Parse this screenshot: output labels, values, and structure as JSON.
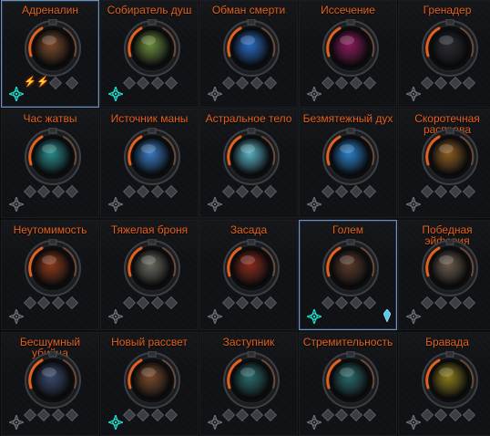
{
  "colors": {
    "label": "#e2611f",
    "selected_border": "#6f8fb8",
    "active_rune": "#20d8c8",
    "inactive_rune": "#6a6e74",
    "crystal": "#56c8e8"
  },
  "abilities": [
    {
      "name": "Адреналин",
      "orb": "#7a4a2a",
      "selected": true,
      "rune": "active",
      "fire_pips": 2
    },
    {
      "name": "Собиратель душ",
      "orb": "#6a8a3a",
      "rune": "active"
    },
    {
      "name": "Обман смерти",
      "orb": "#2a6ac0",
      "rune": "inactive"
    },
    {
      "name": "Иссечение",
      "orb": "#8a1a5a",
      "rune": "inactive"
    },
    {
      "name": "Гренадер",
      "orb": "#2a2a30",
      "rune": "inactive"
    },
    {
      "name": "Час жатвы",
      "orb": "#2a8a8a",
      "rune": "inactive"
    },
    {
      "name": "Источник маны",
      "orb": "#3a7ac0",
      "rune": "inactive"
    },
    {
      "name": "Астральное тело",
      "orb": "#5ab0c0",
      "rune": "inactive"
    },
    {
      "name": "Безмятежный дух",
      "orb": "#2a80c8",
      "rune": "inactive"
    },
    {
      "name": "Скоротечная расправа",
      "orb": "#8a5a20",
      "rune": "inactive"
    },
    {
      "name": "Неутомимость",
      "orb": "#8a3a1a",
      "rune": "inactive"
    },
    {
      "name": "Тяжелая броня",
      "orb": "#6a6a60",
      "rune": "inactive"
    },
    {
      "name": "Засада",
      "orb": "#8a2a1a",
      "rune": "inactive"
    },
    {
      "name": "Голем",
      "orb": "#5a3a2a",
      "selected": true,
      "rune": "active",
      "crystal": true
    },
    {
      "name": "Победная эйфория",
      "orb": "#6a5a4a",
      "rune": "inactive"
    },
    {
      "name": "Бесшумный убийца",
      "orb": "#3a4a6a",
      "rune": "inactive"
    },
    {
      "name": "Новый рассвет",
      "orb": "#7a4a2a",
      "rune": "active"
    },
    {
      "name": "Заступник",
      "orb": "#2a6a6a",
      "rune": "inactive"
    },
    {
      "name": "Стремительность",
      "orb": "#2a6a6a",
      "rune": "inactive"
    },
    {
      "name": "Бравада",
      "orb": "#8a7a1a",
      "rune": "inactive"
    }
  ]
}
